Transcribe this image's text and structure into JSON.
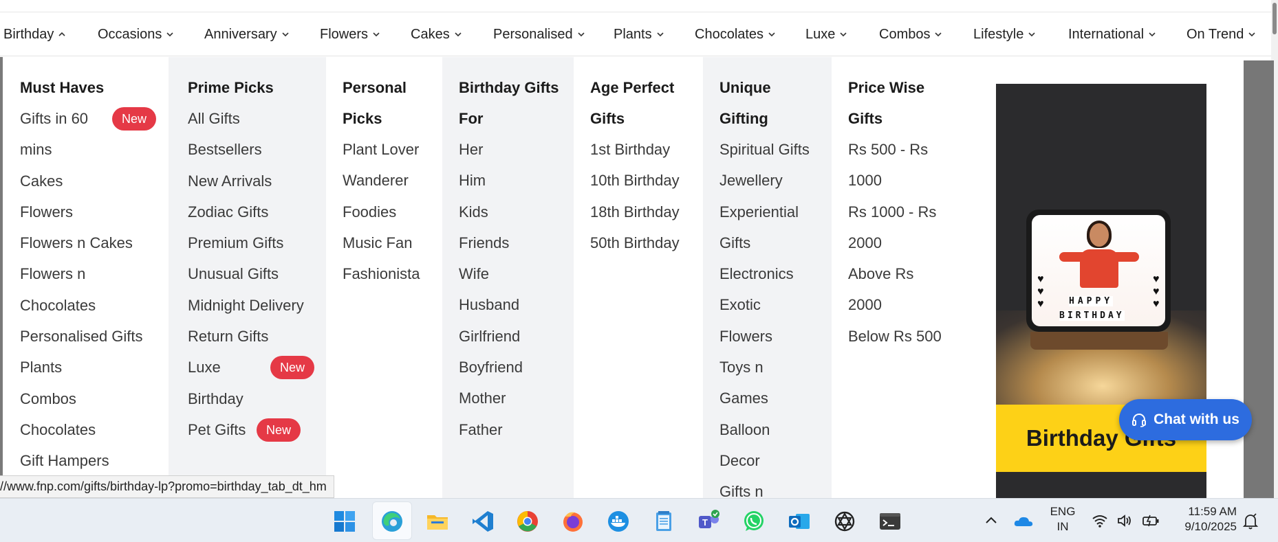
{
  "nav": {
    "items": [
      {
        "label": "Birthday",
        "expanded": true
      },
      {
        "label": "Occasions"
      },
      {
        "label": "Anniversary"
      },
      {
        "label": "Flowers"
      },
      {
        "label": "Cakes"
      },
      {
        "label": "Personalised"
      },
      {
        "label": "Plants"
      },
      {
        "label": "Chocolates"
      },
      {
        "label": "Luxe"
      },
      {
        "label": "Combos"
      },
      {
        "label": "Lifestyle"
      },
      {
        "label": "International"
      },
      {
        "label": "On Trend"
      }
    ]
  },
  "menu": {
    "col1": {
      "head": "Must Haves",
      "links": [
        "Gifts in 60",
        "mins",
        "Cakes",
        "Flowers",
        "Flowers n Cakes",
        "Flowers n",
        "Chocolates",
        "Personalised Gifts",
        "Plants",
        "Combos",
        "Chocolates",
        "Gift Hampers"
      ],
      "badge": "New"
    },
    "col2": {
      "head": "Prime Picks",
      "links": [
        "All Gifts",
        "Bestsellers",
        "New Arrivals",
        "Zodiac Gifts",
        "Premium Gifts",
        "Unusual Gifts",
        "Midnight Delivery",
        "Return Gifts",
        "Luxe",
        "Birthday",
        "Pet Gifts"
      ],
      "badge_luxe": "New",
      "badge_pet": "New"
    },
    "col3": {
      "head1": "Personal",
      "head2": "Picks",
      "links": [
        "Plant Lover",
        "Wanderer",
        "Foodies",
        "Music Fan",
        "Fashionista"
      ]
    },
    "col4": {
      "head1": "Birthday Gifts",
      "head2": "For",
      "links": [
        "Her",
        "Him",
        "Kids",
        "Friends",
        "Wife",
        "Husband",
        "Girlfriend",
        "Boyfriend",
        "Mother",
        "Father"
      ]
    },
    "col5": {
      "head1": "Age Perfect",
      "head2": "Gifts",
      "links": [
        "1st Birthday",
        "10th Birthday",
        "18th Birthday",
        "50th Birthday"
      ]
    },
    "col6": {
      "head1": "Unique",
      "head2": "Gifting",
      "links": [
        "Spiritual Gifts",
        "Jewellery",
        "Experiential",
        "Gifts",
        "Electronics",
        "Exotic",
        "Flowers",
        "Toys n",
        "Games",
        "Balloon",
        "Decor",
        "Gifts n"
      ]
    },
    "col7": {
      "head1": "Price Wise",
      "head2": "Gifts",
      "links": [
        "Rs 500 - Rs",
        "1000",
        "Rs 1000 - Rs",
        "2000",
        "Above Rs",
        "2000",
        "Below Rs 500"
      ]
    }
  },
  "promo": {
    "title": "Birthday Gifts",
    "plaque_line1": "HAPPY",
    "plaque_line2": "BIRTHDAY"
  },
  "chat": {
    "label": "Chat with us"
  },
  "statusbar": {
    "url": "//www.fnp.com/gifts/birthday-lp?promo=birthday_tab_dt_hm"
  },
  "taskbar": {
    "apps": [
      "windows-start",
      "edge",
      "file-explorer",
      "vscode",
      "chrome",
      "firefox",
      "docker",
      "notepad",
      "teams",
      "whatsapp",
      "outlook",
      "chatgpt",
      "terminal"
    ],
    "lang1": "ENG",
    "lang2": "IN",
    "time": "11:59 AM",
    "date": "9/10/2025"
  }
}
